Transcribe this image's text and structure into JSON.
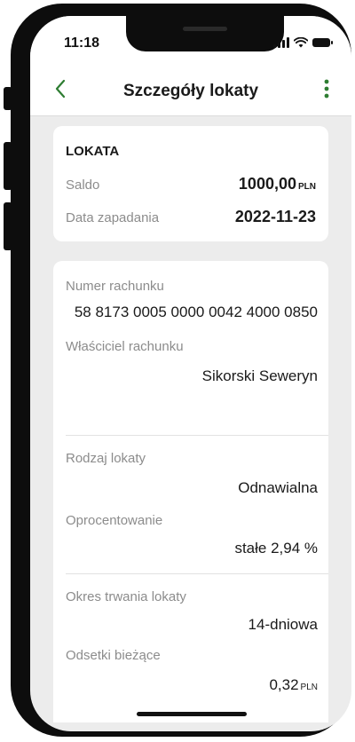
{
  "status_bar": {
    "time": "11:18"
  },
  "header": {
    "title": "Szczegóły lokaty"
  },
  "summary": {
    "section_title": "LOKATA",
    "balance": {
      "label": "Saldo",
      "amount": "1000,00",
      "currency": "PLN"
    },
    "due_date": {
      "label": "Data zapadania",
      "value": "2022-11-23"
    }
  },
  "details": {
    "account_number": {
      "label": "Numer rachunku",
      "value": "58 8173 0005 0000 0042 4000 0850"
    },
    "owner": {
      "label": "Właściciel rachunku",
      "value": "Sikorski Seweryn"
    },
    "deposit_type": {
      "label": "Rodzaj lokaty",
      "value": "Odnawialna"
    },
    "interest_rate": {
      "label": "Oprocentowanie",
      "value": "stałe 2,94 %"
    },
    "duration": {
      "label": "Okres trwania lokaty",
      "value": "14-dniowa"
    },
    "current_interest": {
      "label": "Odsetki bieżące",
      "amount": "0,32",
      "currency": "PLN"
    }
  },
  "colors": {
    "accent": "#2e7d32",
    "label_gray": "#8c8c8c",
    "background": "#ececec"
  }
}
